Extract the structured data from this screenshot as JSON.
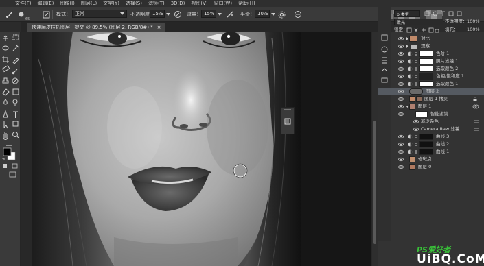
{
  "menubar": {
    "items": [
      "文件(F)",
      "编辑(E)",
      "图像(I)",
      "图层(L)",
      "文字(Y)",
      "选择(S)",
      "滤镜(T)",
      "3D(D)",
      "视图(V)",
      "窗口(W)",
      "帮助(H)"
    ]
  },
  "options": {
    "brush_size": "65",
    "mode_label": "模式：",
    "mode_value": "正常",
    "opacity_label": "不透明度：",
    "opacity_value": "15%",
    "flow_label": "流量：",
    "flow_value": "15%",
    "smooth_label": "平滑：",
    "smooth_value": "10%"
  },
  "document_tab": {
    "title": "快速磨皮技巧图层 · 提交 @ 89.5% (图层 2, RGB/8#) *",
    "close": "×"
  },
  "layers_panel": {
    "filter_label": "ρ 类型",
    "blend_mode": "柔光",
    "opacity_label": "不透明度：",
    "opacity_value": "100%",
    "lock_label": "锁定：",
    "fill_label": "填充：",
    "fill_value": "100%",
    "layers": [
      {
        "name": "对比"
      },
      {
        "name": "观察"
      },
      {
        "name": "色阶 1"
      },
      {
        "name": "照片滤镜 1"
      },
      {
        "name": "选取颜色 2"
      },
      {
        "name": "色相/饱和度 1"
      },
      {
        "name": "选取颜色 1"
      },
      {
        "name": "图层 2"
      },
      {
        "name": "图层 1 拷贝"
      },
      {
        "name": "图层 1"
      },
      {
        "name": "智能滤镜"
      },
      {
        "name": "减少杂色"
      },
      {
        "name": "Camera Raw 滤镜"
      },
      {
        "name": "曲线 3"
      },
      {
        "name": "曲线 2"
      },
      {
        "name": "曲线 1"
      },
      {
        "name": "修斑点"
      },
      {
        "name": "图层 0"
      }
    ]
  },
  "watermark": {
    "brand": "PS爱好者",
    "site": "UiBQ.CoM"
  },
  "colors": {
    "accent_green": "#3fbf3f",
    "selected_row": "#555a61"
  }
}
